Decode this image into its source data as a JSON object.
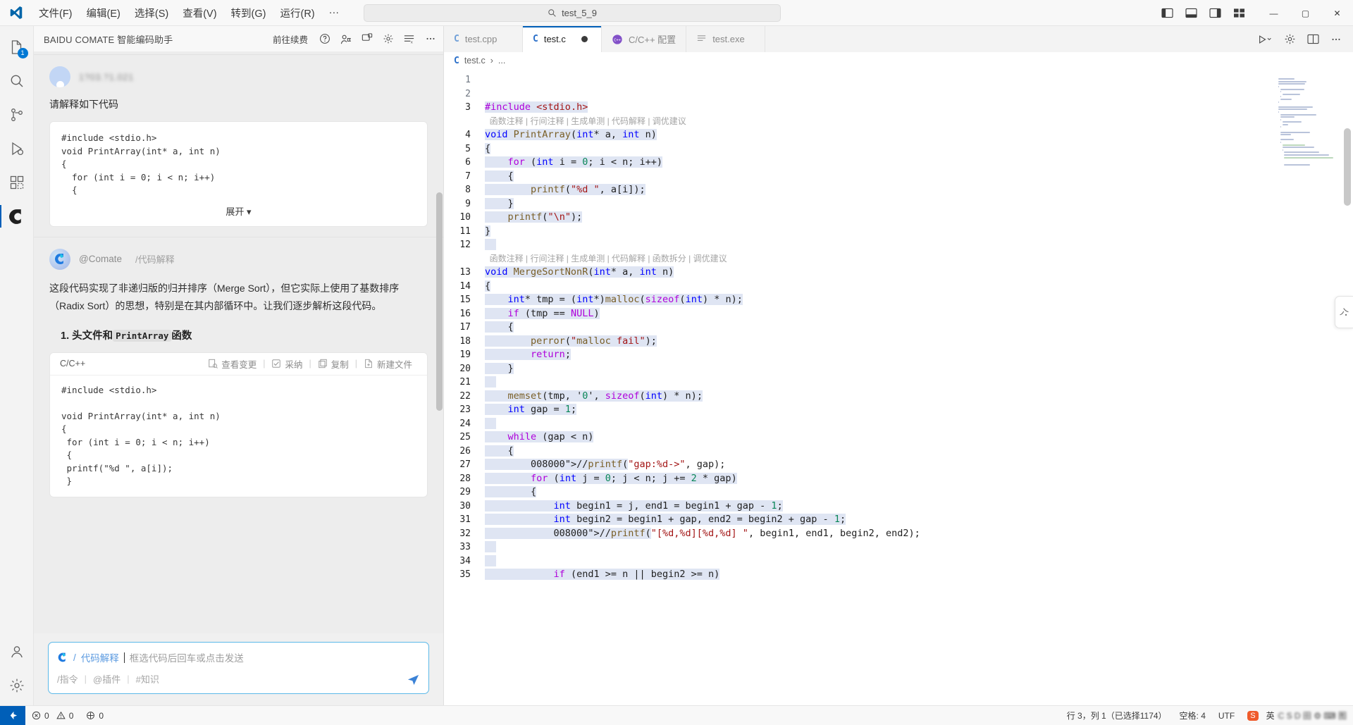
{
  "titlebar": {
    "app_icon": "vscode-logo-icon",
    "menus": [
      "文件(F)",
      "编辑(E)",
      "选择(S)",
      "查看(V)",
      "转到(G)",
      "运行(R)",
      "···"
    ],
    "nav_back": "←",
    "nav_forward": "→",
    "search": {
      "icon": "search-icon",
      "value": "test_5_9"
    },
    "layout_icons": [
      "toggle-primary-sidebar-icon",
      "toggle-panel-icon",
      "toggle-secondary-sidebar-icon",
      "customize-layout-icon"
    ],
    "window_controls": {
      "minimize": "—",
      "maximize": "▢",
      "close": "✕"
    }
  },
  "activitybar": {
    "items": [
      {
        "name": "explorer",
        "icon": "files-icon",
        "badge": "1"
      },
      {
        "name": "search",
        "icon": "search-icon",
        "badge": ""
      },
      {
        "name": "source-control",
        "icon": "source-control-icon",
        "badge": ""
      },
      {
        "name": "run-and-debug",
        "icon": "run-debug-icon",
        "badge": ""
      },
      {
        "name": "extensions",
        "icon": "extensions-icon",
        "badge": ""
      },
      {
        "name": "comate",
        "icon": "comate-icon",
        "badge": ""
      }
    ],
    "bottom": [
      {
        "name": "accounts",
        "icon": "account-icon"
      },
      {
        "name": "settings",
        "icon": "gear-icon"
      }
    ]
  },
  "comate": {
    "title": "BAIDU COMATE 智能编码助手",
    "renew_label": "前往续费",
    "header_icons": [
      "help-icon",
      "feedback-icon",
      "new-chat-icon",
      "settings-gear-icon",
      "history-icon",
      "more-icon"
    ],
    "user_message": {
      "avatar": "user-avatar",
      "username": "1?03.?1.021",
      "text": "请解释如下代码",
      "code": "#include <stdio.h>\nvoid PrintArray(int* a, int n)\n{\n  for (int i = 0; i < n; i++)\n  {",
      "expand_label": "展开 ▾"
    },
    "bot_message": {
      "avatar": "comate-avatar",
      "name": "@Comate",
      "command": "/代码解释",
      "paragraph": "这段代码实现了非递归版的归并排序（Merge Sort），但它实际上使用了基数排序（Radix Sort）的思想，特别是在其内部循环中。让我们逐步解析这段代码。",
      "heading_num": "1.",
      "heading_before": "头文件和",
      "heading_code": "PrintArray",
      "heading_after": "函数",
      "snippet": {
        "lang": "C/C++",
        "actions": [
          {
            "label": "查看变更",
            "icon": "diff-icon"
          },
          {
            "label": "采纳",
            "icon": "check-icon"
          },
          {
            "label": "复制",
            "icon": "copy-icon"
          },
          {
            "label": "新建文件",
            "icon": "new-file-icon"
          }
        ],
        "code": "#include <stdio.h>\n\nvoid PrintArray(int* a, int n)\n{\n for (int i = 0; i < n; i++)\n {\n printf(\"%d \", a[i]);\n }"
      }
    },
    "composer": {
      "icon": "comate-small-icon",
      "slash": "/",
      "command": "代码解释",
      "placeholder": "框选代码后回车或点击发送",
      "hints": [
        "/指令",
        "@插件",
        "#知识"
      ],
      "send_icon": "send-icon"
    }
  },
  "editor": {
    "tabs": [
      {
        "label": "test.cpp",
        "icon": "cpp-file-icon",
        "active": false,
        "dirty": false
      },
      {
        "label": "test.c",
        "icon": "c-file-icon",
        "active": true,
        "dirty": true
      },
      {
        "label": "C/C++ 配置",
        "icon": "cpp-config-icon",
        "active": false,
        "dirty": false
      },
      {
        "label": "test.exe",
        "icon": "exe-file-icon",
        "active": false,
        "dirty": false
      }
    ],
    "tab_actions": [
      "run-icon",
      "settings-gear-icon",
      "split-editor-icon",
      "more-actions-icon"
    ],
    "breadcrumb": {
      "icon": "c-file-icon",
      "file": "test.c",
      "sep": "›",
      "rest": "..."
    },
    "codelens": "函数注释 | 行间注释 | 生成单测 | 代码解释 | 调优建议",
    "codelens2": "函数注释 | 行间注释 | 生成单测 | 代码解释 | 函数拆分 | 调优建议",
    "lines": [
      {
        "no": "1",
        "text": "",
        "sel": false
      },
      {
        "no": "2",
        "text": "",
        "sel": false
      },
      {
        "no": "3",
        "text": "#include <stdio.h>",
        "sel": true
      },
      {
        "no": "_codelens1",
        "text": "函数注释 | 行间注释 | 生成单测 | 代码解释 | 调优建议",
        "sel": false
      },
      {
        "no": "4",
        "text": "void PrintArray(int* a, int n)",
        "sel": true
      },
      {
        "no": "5",
        "text": "{",
        "sel": true
      },
      {
        "no": "6",
        "text": "    for (int i = 0; i < n; i++)",
        "sel": true
      },
      {
        "no": "7",
        "text": "    {",
        "sel": true
      },
      {
        "no": "8",
        "text": "        printf(\"%d \", a[i]);",
        "sel": true
      },
      {
        "no": "9",
        "text": "    }",
        "sel": true
      },
      {
        "no": "10",
        "text": "    printf(\"\\n\");",
        "sel": true
      },
      {
        "no": "11",
        "text": "}",
        "sel": true
      },
      {
        "no": "12",
        "text": "",
        "sel": true
      },
      {
        "no": "_codelens2",
        "text": "函数注释 | 行间注释 | 生成单测 | 代码解释 | 函数拆分 | 调优建议",
        "sel": false
      },
      {
        "no": "13",
        "text": "void MergeSortNonR(int* a, int n)",
        "sel": true
      },
      {
        "no": "14",
        "text": "{",
        "sel": true
      },
      {
        "no": "15",
        "text": "    int* tmp = (int*)malloc(sizeof(int) * n);",
        "sel": true
      },
      {
        "no": "16",
        "text": "    if (tmp == NULL)",
        "sel": true
      },
      {
        "no": "17",
        "text": "    {",
        "sel": true
      },
      {
        "no": "18",
        "text": "        perror(\"malloc fail\");",
        "sel": true
      },
      {
        "no": "19",
        "text": "        return;",
        "sel": true
      },
      {
        "no": "20",
        "text": "    }",
        "sel": true
      },
      {
        "no": "21",
        "text": "",
        "sel": true
      },
      {
        "no": "22",
        "text": "    memset(tmp, '0', sizeof(int) * n);",
        "sel": true
      },
      {
        "no": "23",
        "text": "    int gap = 1;",
        "sel": true
      },
      {
        "no": "24",
        "text": "",
        "sel": true
      },
      {
        "no": "25",
        "text": "    while (gap < n)",
        "sel": true
      },
      {
        "no": "26",
        "text": "    {",
        "sel": true
      },
      {
        "no": "27",
        "text": "        //printf(\"gap:%d->\", gap);",
        "sel": true
      },
      {
        "no": "28",
        "text": "        for (int j = 0; j < n; j += 2 * gap)",
        "sel": true
      },
      {
        "no": "29",
        "text": "        {",
        "sel": true
      },
      {
        "no": "30",
        "text": "            int begin1 = j, end1 = begin1 + gap - 1;",
        "sel": true
      },
      {
        "no": "31",
        "text": "            int begin2 = begin1 + gap, end2 = begin2 + gap - 1;",
        "sel": true
      },
      {
        "no": "32",
        "text": "            //printf(\"[%d,%d][%d,%d] \", begin1, end1, begin2, end2);",
        "sel": true
      },
      {
        "no": "33",
        "text": "",
        "sel": true
      },
      {
        "no": "34",
        "text": "",
        "sel": true
      },
      {
        "no": "35",
        "text": "            if (end1 >= n || begin2 >= n)",
        "sel": true
      }
    ]
  },
  "statusbar": {
    "remote_icon": "remote-window-icon",
    "errors": {
      "icon": "error-icon",
      "count": "0"
    },
    "warnings": {
      "icon": "warning-icon",
      "count": "0"
    },
    "ports": {
      "icon": "ports-icon",
      "count": "0"
    },
    "cursor": "行 3，列 1（已选择1174）",
    "spaces": "空格: 4",
    "encoding": "UTF",
    "ime_badge": "S",
    "ime_lang": "英",
    "ime_extra": "C S D 田 ⚙ ⌨ 图"
  }
}
